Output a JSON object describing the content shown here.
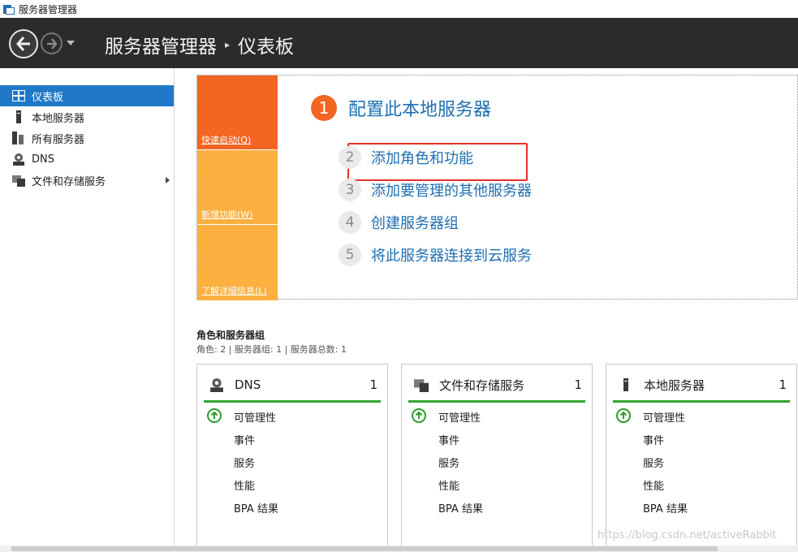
{
  "window": {
    "title": "服务器管理器",
    "icon": "server-manager-icon"
  },
  "header": {
    "title": "服务器管理器",
    "separator": "▸",
    "page": "仪表板"
  },
  "sidebar": {
    "items": [
      {
        "label": "仪表板",
        "icon": "dashboard-icon",
        "active": true
      },
      {
        "label": "本地服务器",
        "icon": "server-icon"
      },
      {
        "label": "所有服务器",
        "icon": "servers-icon"
      },
      {
        "label": "DNS",
        "icon": "dns-icon"
      },
      {
        "label": "文件和存储服务",
        "icon": "file-storage-icon",
        "has_submenu": true
      }
    ]
  },
  "quick_start": {
    "tiles": [
      {
        "label": "快速启动(Q)"
      },
      {
        "label": "新增功能(W)"
      },
      {
        "label": "了解详细信息(L)"
      }
    ],
    "main_step": {
      "num": "1",
      "label": "配置此本地服务器"
    },
    "steps": [
      {
        "num": "2",
        "label": "添加角色和功能"
      },
      {
        "num": "3",
        "label": "添加要管理的其他服务器"
      },
      {
        "num": "4",
        "label": "创建服务器组"
      },
      {
        "num": "5",
        "label": "将此服务器连接到云服务"
      }
    ]
  },
  "roles": {
    "title": "角色和服务器组",
    "subtitle": "角色: 2 | 服务器组: 1 | 服务器总数: 1",
    "cards": [
      {
        "name": "DNS",
        "count": "1",
        "icon": "dns-icon",
        "rows": [
          "可管理性",
          "事件",
          "服务",
          "性能",
          "BPA 结果"
        ]
      },
      {
        "name": "文件和存储服务",
        "count": "1",
        "icon": "file-storage-icon",
        "rows": [
          "可管理性",
          "事件",
          "服务",
          "性能",
          "BPA 结果"
        ]
      },
      {
        "name": "本地服务器",
        "count": "1",
        "icon": "server-icon",
        "rows": [
          "可管理性",
          "事件",
          "服务",
          "性能",
          "BPA 结果"
        ]
      }
    ]
  },
  "watermark": "https://blog.csdn.net/activeRabbit",
  "colors": {
    "accent_blue": "#1f6fb2",
    "header_bg": "#2b2b2b",
    "tile_orange": "#f26522",
    "tile_yellow": "#fbb040",
    "status_green": "#33a532",
    "highlight_red": "#e5312b"
  }
}
